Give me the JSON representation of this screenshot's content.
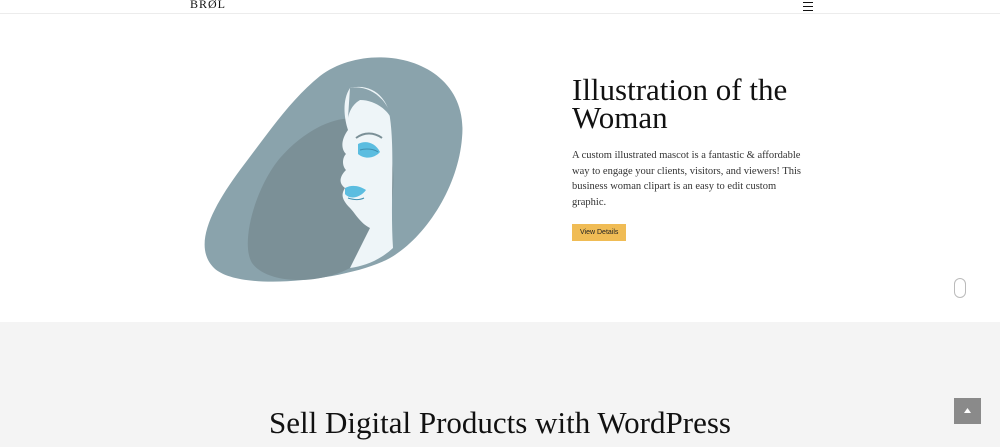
{
  "header": {
    "logo_text": "BRØL",
    "menu_icon": "hamburger-menu-icon"
  },
  "hero": {
    "title": "Illustration of the Woman",
    "description": "A custom illustrated mascot is a fantastic & affordable way to engage your clients, visitors, and viewers! This business woman clipart is an easy to edit custom graphic.",
    "button_label": "View Details",
    "illustration_icon": "woman-illustration",
    "colors": {
      "hair": "#8aa3ac",
      "hair_shadow": "#7b9097",
      "skin": "#eef5f8",
      "eye": "#5bbde0",
      "button": "#f0bc55"
    }
  },
  "scroll_indicator_icon": "mouse-scroll-icon",
  "section2": {
    "title": "Sell Digital Products with WordPress"
  },
  "back_to_top_icon": "arrow-up-icon"
}
